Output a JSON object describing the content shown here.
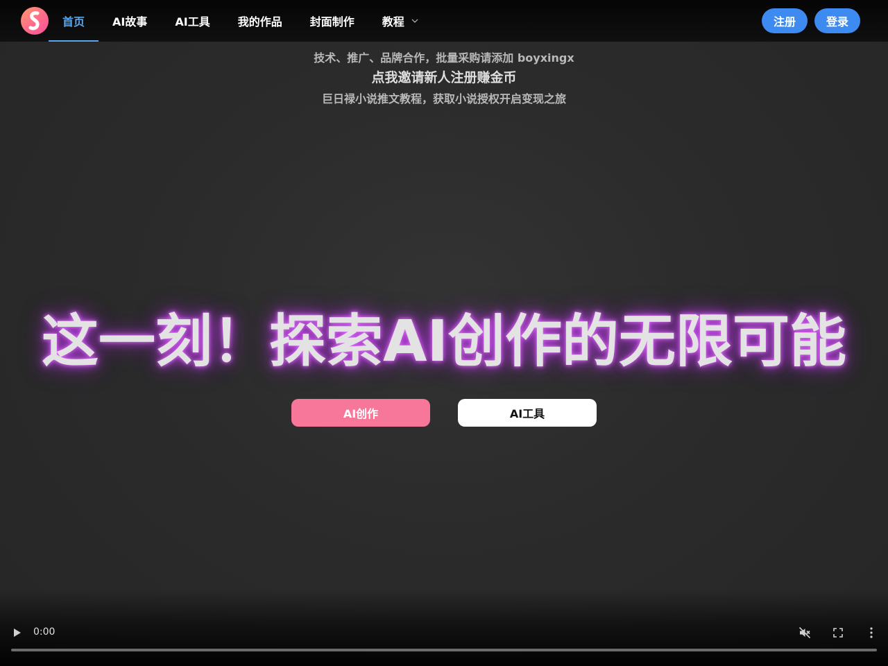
{
  "colors": {
    "nav_active": "#5aa7ee",
    "auth_button": "#3d8af0",
    "cta_primary": "#f7779a",
    "cta_secondary": "#ffffff",
    "hero_glow": "#c850f0"
  },
  "logo": {
    "icon": "brand-s-logo-icon"
  },
  "nav": {
    "items": [
      {
        "label": "首页",
        "active": true
      },
      {
        "label": "AI故事",
        "active": false
      },
      {
        "label": "AI工具",
        "active": false
      },
      {
        "label": "我的作品",
        "active": false
      },
      {
        "label": "封面制作",
        "active": false
      },
      {
        "label": "教程",
        "active": false,
        "icon": "chevron-down-icon"
      }
    ]
  },
  "auth": {
    "register_label": "注册",
    "login_label": "登录"
  },
  "notices": {
    "line1": "技术、推广、品牌合作，批量采购请添加 boyxingx",
    "line2": "点我邀请新人注册赚金币",
    "line3": "巨日禄小说推文教程，获取小说授权开启变现之旅"
  },
  "hero": {
    "title": "这一刻！探索AI创作的无限可能",
    "primary_button": "AI创作",
    "secondary_button": "AI工具"
  },
  "video": {
    "time": "0:00",
    "icons": [
      "play-icon",
      "muted-icon",
      "fullscreen-icon",
      "more-vertical-icon"
    ],
    "progress": 0
  }
}
